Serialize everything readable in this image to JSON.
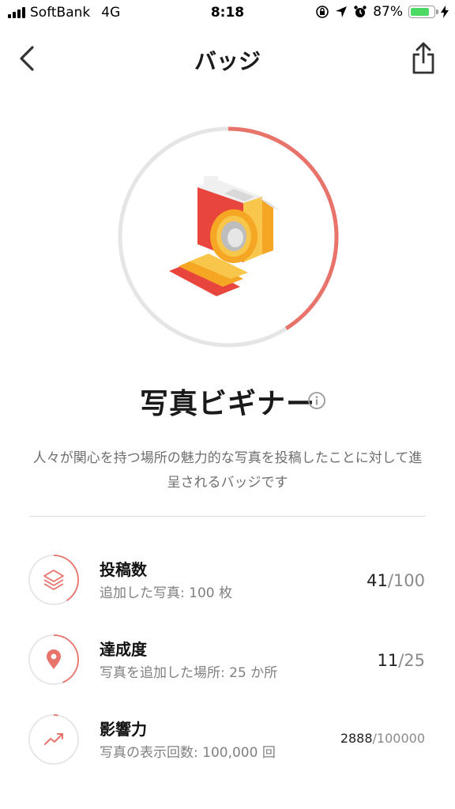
{
  "status_bar": {
    "carrier": "SoftBank",
    "network": "4G",
    "time": "8:18",
    "battery": "87%",
    "battery_level": 0.87,
    "battery_color": "#4cd964"
  },
  "nav": {
    "title": "バッジ",
    "back_icon": "chevron-left-icon",
    "share_icon": "share-icon"
  },
  "badge": {
    "name": "写真ビギナー",
    "progress": 0.41,
    "icon": "camera-badge-icon",
    "description": "人々が関心を持つ場所の魅力的な写真を投稿したことに対して進呈されるバッジです",
    "accent_color": "#e8736b"
  },
  "stats": [
    {
      "label": "投稿数",
      "sub": "追加した写真: 100 枚",
      "current": "41",
      "total": "/100",
      "progress": 0.41,
      "icon": "layers-icon"
    },
    {
      "label": "達成度",
      "sub": "写真を追加した場所: 25 か所",
      "current": "11",
      "total": "/25",
      "progress": 0.44,
      "icon": "map-pin-icon"
    },
    {
      "label": "影響力",
      "sub": "写真の表示回数: 100,000 回",
      "current": "2888",
      "total": "/100000",
      "progress": 0.0289,
      "icon": "trending-up-icon"
    }
  ]
}
